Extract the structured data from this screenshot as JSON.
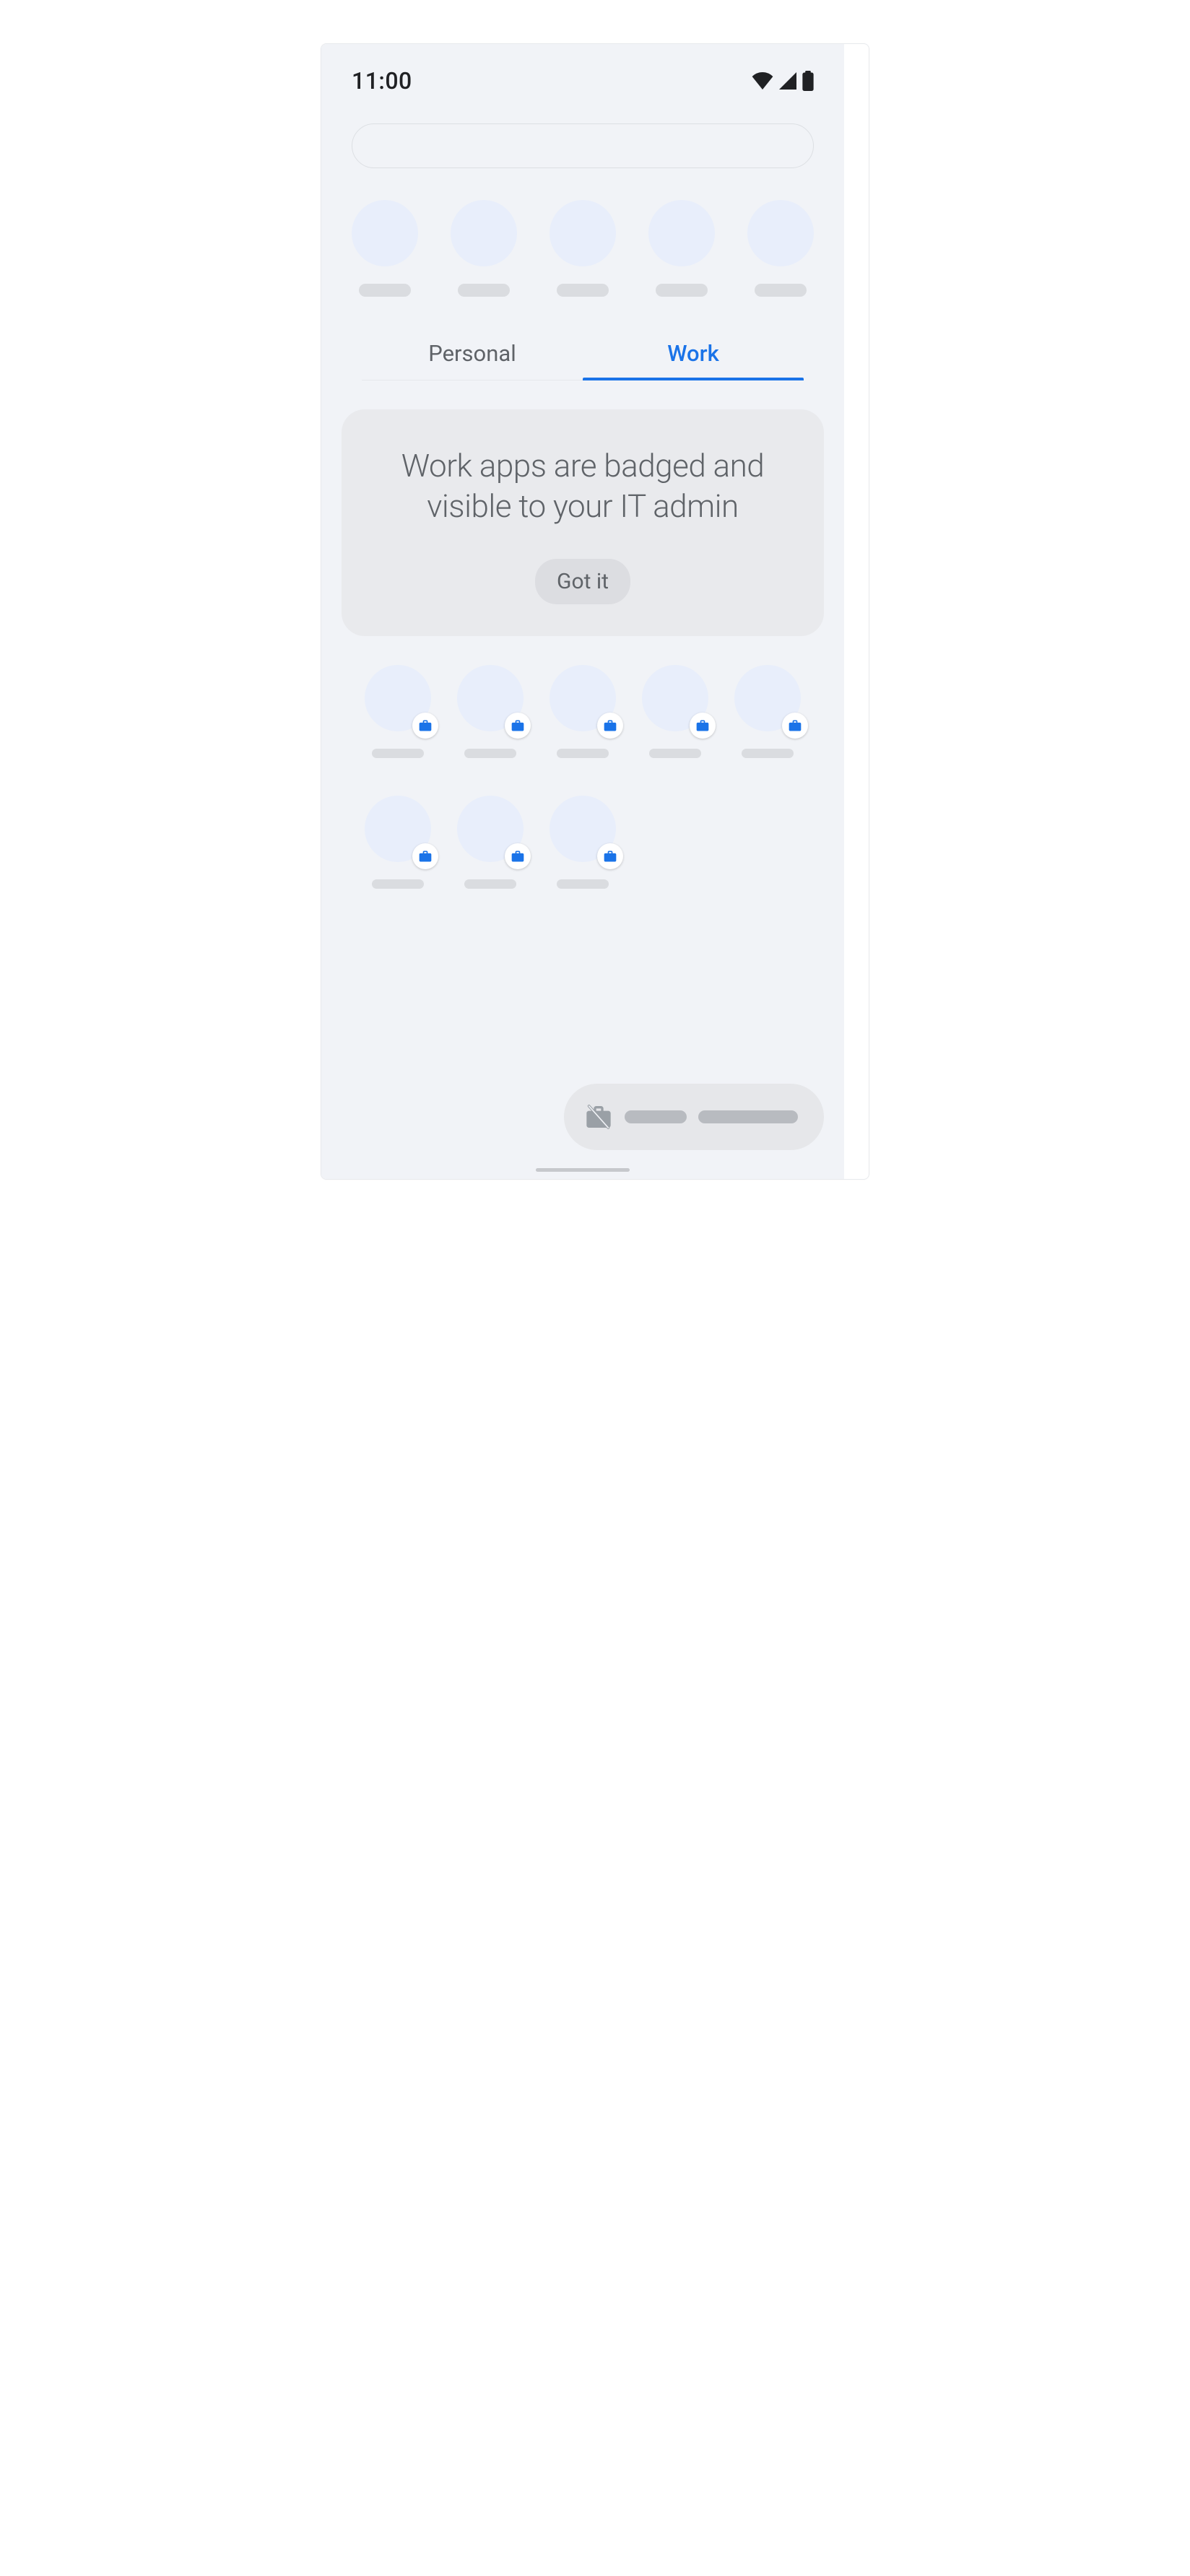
{
  "status": {
    "time": "11:00",
    "wifi_icon": "wifi-icon",
    "cell_icon": "cell-signal-icon",
    "battery_icon": "battery-full-icon"
  },
  "tabs": {
    "personal": "Personal",
    "work": "Work",
    "active": "work"
  },
  "banner": {
    "text": "Work apps are badged and visible to your IT admin",
    "button": "Got it"
  },
  "suggestions_count": 5,
  "work_apps_count": 8,
  "bottom_chip": {
    "icon": "briefcase-off-icon"
  }
}
